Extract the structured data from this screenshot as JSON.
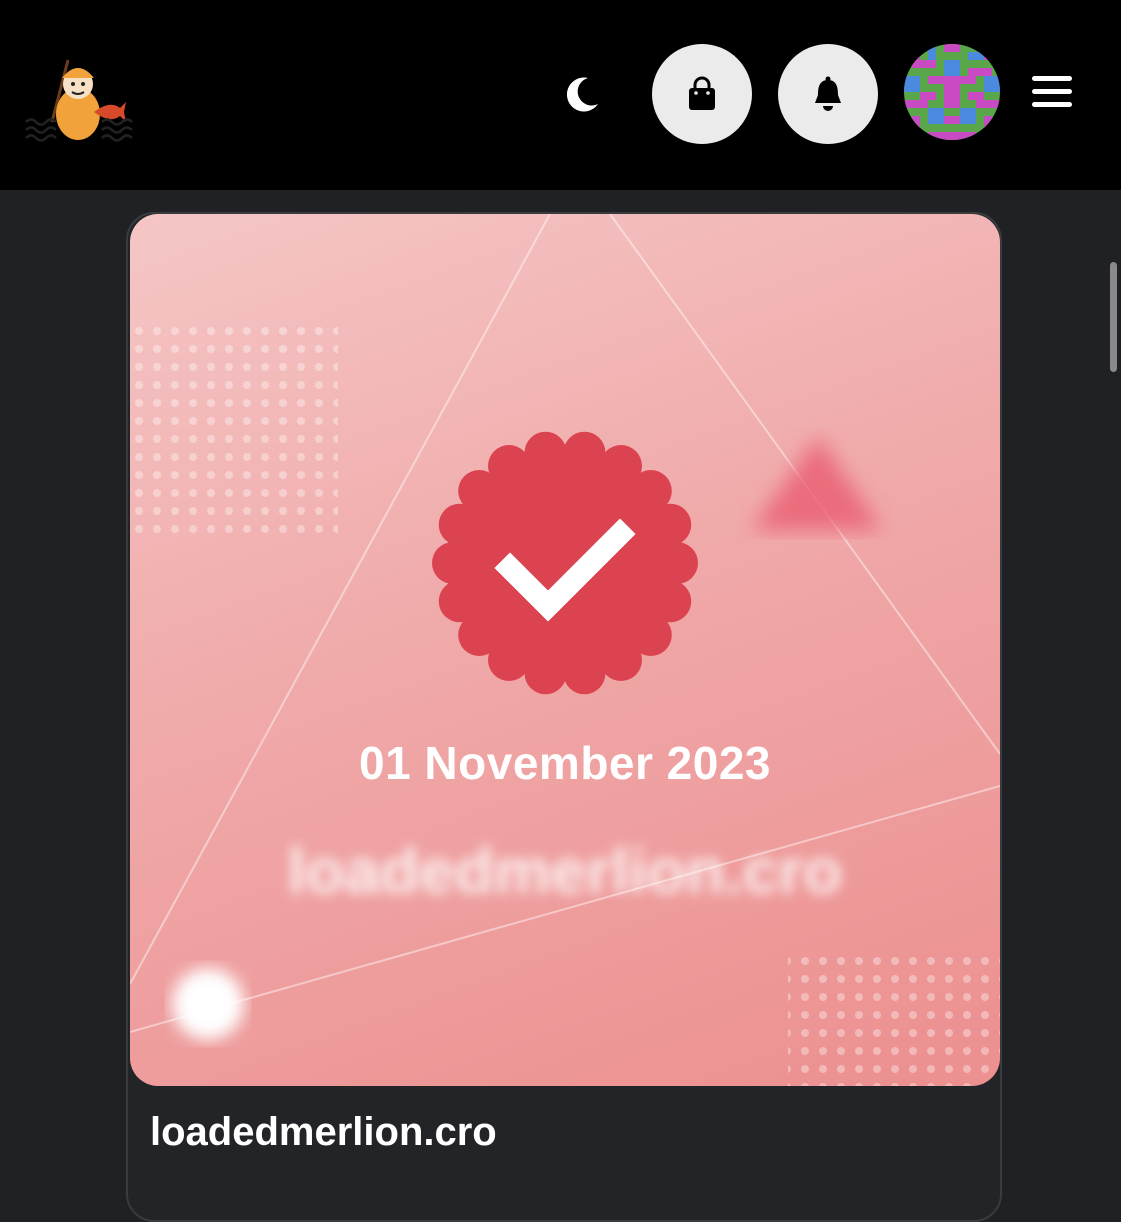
{
  "header": {
    "logo_icon": "merlion-fisherman-logo",
    "theme_toggle_icon": "moon-icon",
    "cart_icon": "shopping-bag-icon",
    "notifications_icon": "bell-icon",
    "avatar_icon": "pixel-avatar",
    "menu_icon": "hamburger-menu-icon"
  },
  "nft_card": {
    "badge_icon": "verified-check-badge-icon",
    "mint_date": "01 November 2023",
    "image_name": "loadedmerlion.cro",
    "domain_name": "loadedmerlion.cro"
  },
  "colors": {
    "header_bg": "#000000",
    "page_bg": "#202124",
    "badge_red": "#dc4350",
    "card_pink": "#f0a9a9"
  }
}
